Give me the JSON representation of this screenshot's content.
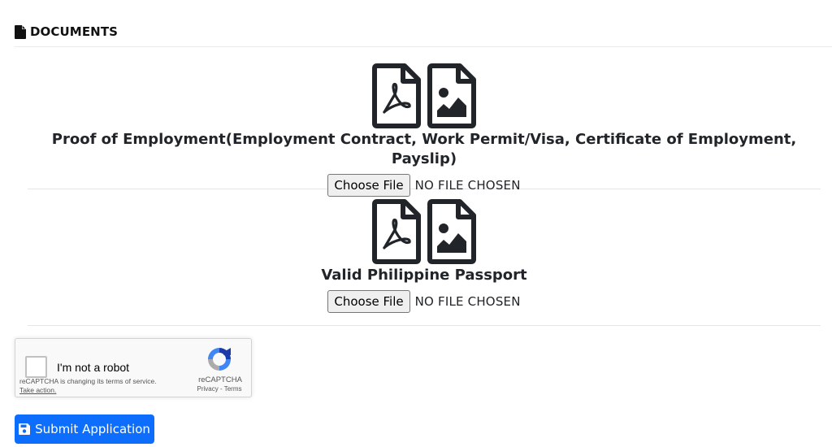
{
  "section": {
    "title": "DOCUMENTS",
    "icon": "file-icon"
  },
  "documents": [
    {
      "label": "Proof of Employment(Employment Contract, Work Permit/Visa, Certificate of Employment, Payslip)",
      "button_label": "Choose File",
      "file_status": "NO FILE CHOSEN",
      "icons": [
        "file-pdf-icon",
        "file-image-icon"
      ]
    },
    {
      "label": "Valid Philippine Passport",
      "button_label": "Choose File",
      "file_status": "NO FILE CHOSEN",
      "icons": [
        "file-pdf-icon",
        "file-image-icon"
      ]
    }
  ],
  "recaptcha": {
    "label": "I'm not a robot",
    "notice": "reCAPTCHA is changing its terms of service.",
    "take_action": "Take action.",
    "brand": "reCAPTCHA",
    "links": "Privacy - Terms"
  },
  "submit": {
    "label": "Submit Application",
    "icon": "save-icon"
  },
  "colors": {
    "primary": "#0d6efd",
    "icon_dark": "#212529"
  }
}
